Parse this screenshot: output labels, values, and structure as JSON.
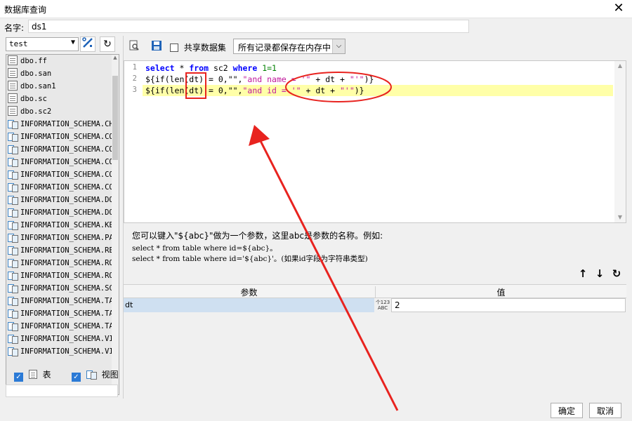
{
  "window": {
    "title": "数据库查询",
    "close_icon": "close-icon"
  },
  "name_field": {
    "label": "名字:",
    "value": "ds1"
  },
  "left_panel": {
    "connection": "test",
    "tables": [
      {
        "name": "dbo.ff",
        "kind": "table"
      },
      {
        "name": "dbo.san",
        "kind": "table"
      },
      {
        "name": "dbo.san1",
        "kind": "table"
      },
      {
        "name": "dbo.sc",
        "kind": "table"
      },
      {
        "name": "dbo.sc2",
        "kind": "table"
      },
      {
        "name": "INFORMATION_SCHEMA.CHE",
        "kind": "view"
      },
      {
        "name": "INFORMATION_SCHEMA.COL",
        "kind": "view"
      },
      {
        "name": "INFORMATION_SCHEMA.COL",
        "kind": "view"
      },
      {
        "name": "INFORMATION_SCHEMA.COL",
        "kind": "view"
      },
      {
        "name": "INFORMATION_SCHEMA.CON",
        "kind": "view"
      },
      {
        "name": "INFORMATION_SCHEMA.CON",
        "kind": "view"
      },
      {
        "name": "INFORMATION_SCHEMA.DOM",
        "kind": "view"
      },
      {
        "name": "INFORMATION_SCHEMA.DOM",
        "kind": "view"
      },
      {
        "name": "INFORMATION_SCHEMA.KEY",
        "kind": "view"
      },
      {
        "name": "INFORMATION_SCHEMA.PAR",
        "kind": "view"
      },
      {
        "name": "INFORMATION_SCHEMA.REF",
        "kind": "view"
      },
      {
        "name": "INFORMATION_SCHEMA.ROU",
        "kind": "view"
      },
      {
        "name": "INFORMATION_SCHEMA.ROU",
        "kind": "view"
      },
      {
        "name": "INFORMATION_SCHEMA.SCH",
        "kind": "view"
      },
      {
        "name": "INFORMATION_SCHEMA.TAB",
        "kind": "view"
      },
      {
        "name": "INFORMATION_SCHEMA.TAB",
        "kind": "view"
      },
      {
        "name": "INFORMATION_SCHEMA.TAB",
        "kind": "view"
      },
      {
        "name": "INFORMATION_SCHEMA.VIE",
        "kind": "view"
      },
      {
        "name": "INFORMATION_SCHEMA.VIE",
        "kind": "view"
      }
    ],
    "show_tables_label": "表",
    "show_views_label": "视图"
  },
  "toolbar": {
    "share_dataset_label": "共享数据集",
    "memory_option": "所有记录都保存在内存中"
  },
  "editor": {
    "line_numbers": [
      "1",
      "2",
      "3"
    ],
    "lines": [
      [
        {
          "t": "select",
          "c": "kw"
        },
        {
          "t": " * ",
          "c": "op"
        },
        {
          "t": "from",
          "c": "kw"
        },
        {
          "t": " sc2 ",
          "c": "op"
        },
        {
          "t": "where",
          "c": "kw"
        },
        {
          "t": " 1=1",
          "c": "num"
        }
      ],
      [
        {
          "t": "${if(len(dt) = 0,\"\",",
          "c": "op"
        },
        {
          "t": "\"and name = '\"",
          "c": "str"
        },
        {
          "t": " + dt + ",
          "c": "op"
        },
        {
          "t": "\"'\"",
          "c": "str"
        },
        {
          "t": ")}",
          "c": "op"
        }
      ],
      [
        {
          "t": "${if(len(dt) = 0,\"\",",
          "c": "op"
        },
        {
          "t": "\"and id = '\"",
          "c": "str"
        },
        {
          "t": " + dt + ",
          "c": "op"
        },
        {
          "t": "\"'\"",
          "c": "str"
        },
        {
          "t": ")}",
          "c": "op"
        }
      ]
    ]
  },
  "hint": {
    "line1": "您可以键入\"${abc}\"做为一个参数，这里abc是参数的名称。例如:",
    "line2": "select * from table where id=${abc}。",
    "line3": "select * from table where id='${abc}'。(如果id字段为字符串类型)"
  },
  "params_table": {
    "col_param": "参数",
    "col_value": "值",
    "rows": [
      {
        "name": "dt",
        "type_top": "个123",
        "type_bottom": "ABC",
        "value": "2"
      }
    ]
  },
  "footer": {
    "ok_label": "确定",
    "cancel_label": "取消"
  },
  "colors": {
    "annotation": "#e8231f",
    "highlight_line": "#ffffa8",
    "keyword": "#0000ff",
    "string": "#c0189c",
    "number": "#008000",
    "selected_row": "#cfe0f1"
  }
}
